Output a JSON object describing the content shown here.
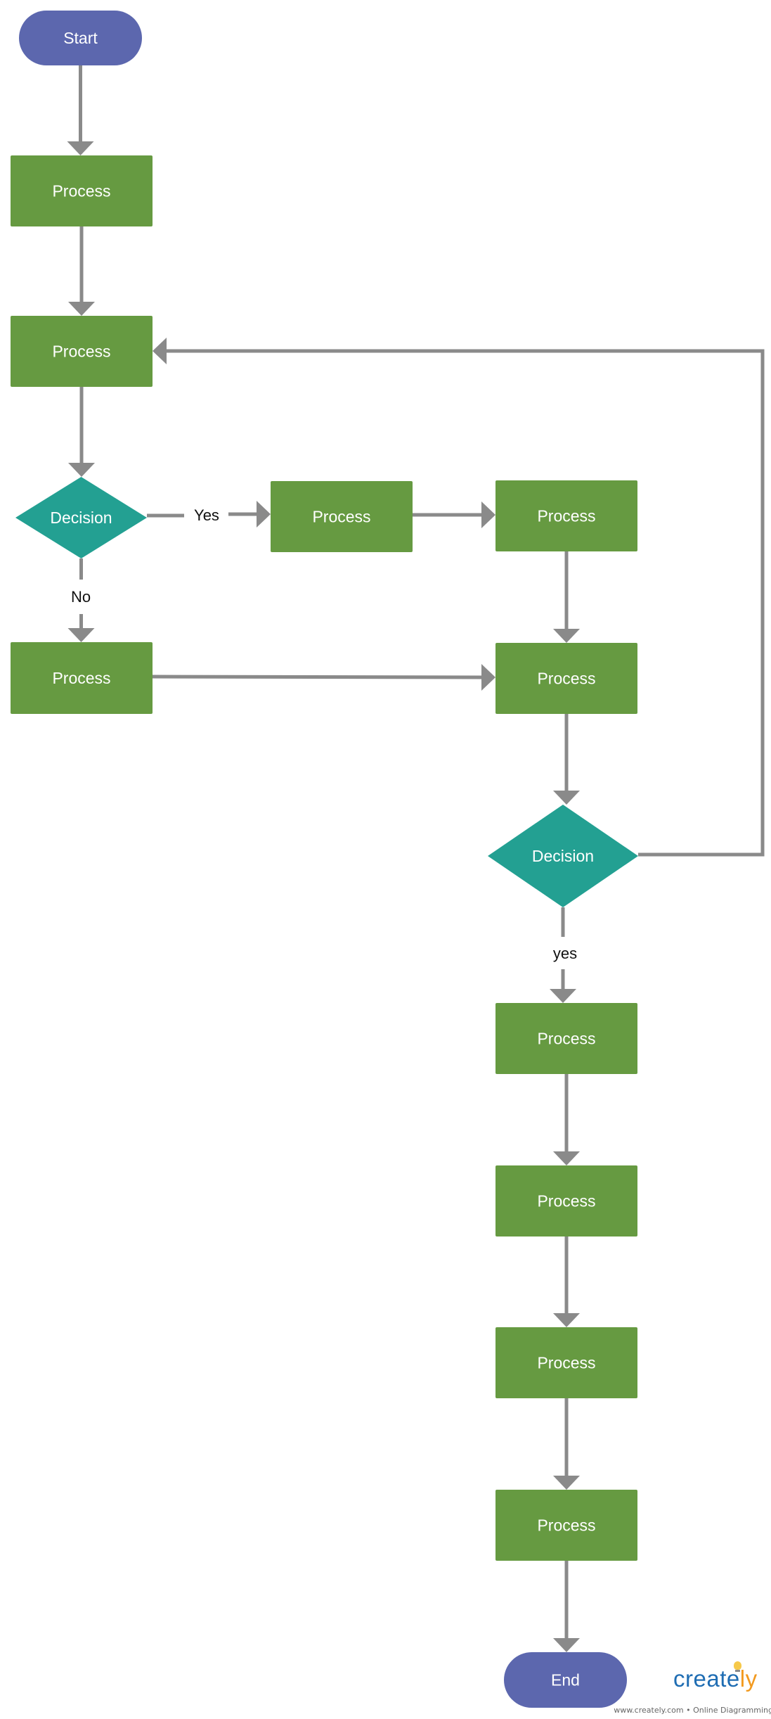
{
  "diagram": {
    "type": "flowchart",
    "colors": {
      "terminator": "#5c67ae",
      "process": "#669a41",
      "decision": "#23a092",
      "connector": "#8a8a8a",
      "node_text": "#ffffff",
      "label_text": "#111111"
    },
    "nodes": [
      {
        "id": "start",
        "kind": "terminator",
        "label": "Start"
      },
      {
        "id": "p1",
        "kind": "process",
        "label": "Process"
      },
      {
        "id": "p2",
        "kind": "process",
        "label": "Process"
      },
      {
        "id": "d1",
        "kind": "decision",
        "label": "Decision"
      },
      {
        "id": "p3",
        "kind": "process",
        "label": "Process"
      },
      {
        "id": "p4",
        "kind": "process",
        "label": "Process"
      },
      {
        "id": "pno",
        "kind": "process",
        "label": "Process"
      },
      {
        "id": "p5",
        "kind": "process",
        "label": "Process"
      },
      {
        "id": "d2",
        "kind": "decision",
        "label": "Decision"
      },
      {
        "id": "p6",
        "kind": "process",
        "label": "Process"
      },
      {
        "id": "p7",
        "kind": "process",
        "label": "Process"
      },
      {
        "id": "p8",
        "kind": "process",
        "label": "Process"
      },
      {
        "id": "p9",
        "kind": "process",
        "label": "Process"
      },
      {
        "id": "end",
        "kind": "terminator",
        "label": "End"
      }
    ],
    "edges": [
      {
        "from": "start",
        "to": "p1",
        "label": ""
      },
      {
        "from": "p1",
        "to": "p2",
        "label": ""
      },
      {
        "from": "p2",
        "to": "d1",
        "label": ""
      },
      {
        "from": "d1",
        "to": "p3",
        "label": "Yes"
      },
      {
        "from": "d1",
        "to": "pno",
        "label": "No"
      },
      {
        "from": "p3",
        "to": "p4",
        "label": ""
      },
      {
        "from": "p4",
        "to": "p5",
        "label": ""
      },
      {
        "from": "pno",
        "to": "p5",
        "label": ""
      },
      {
        "from": "p5",
        "to": "d2",
        "label": ""
      },
      {
        "from": "d2",
        "to": "p2",
        "label": ""
      },
      {
        "from": "d2",
        "to": "p6",
        "label": "yes"
      },
      {
        "from": "p6",
        "to": "p7",
        "label": ""
      },
      {
        "from": "p7",
        "to": "p8",
        "label": ""
      },
      {
        "from": "p8",
        "to": "p9",
        "label": ""
      },
      {
        "from": "p9",
        "to": "end",
        "label": ""
      }
    ]
  },
  "branding": {
    "logo_part1": "creat",
    "logo_part2": "e",
    "logo_part3": "ly",
    "tagline": "www.creately.com • Online Diagramming"
  }
}
